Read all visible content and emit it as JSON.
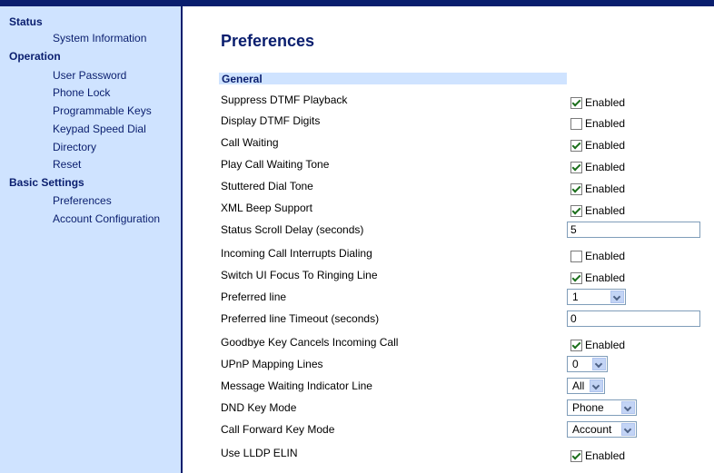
{
  "sidebar": {
    "status_heading": "Status",
    "status_items": [
      "System Information"
    ],
    "operation_heading": "Operation",
    "operation_items": [
      "User Password",
      "Phone Lock",
      "Programmable Keys",
      "Keypad Speed Dial",
      "Directory",
      "Reset"
    ],
    "basic_heading": "Basic Settings",
    "basic_items": [
      "Preferences",
      "Account Configuration"
    ]
  },
  "main": {
    "title": "Preferences",
    "section": "General",
    "rows": [
      {
        "label": "Suppress DTMF Playback",
        "type": "checkbox",
        "checked": true,
        "option_label": "Enabled"
      },
      {
        "label": "Display DTMF Digits",
        "type": "checkbox",
        "checked": false,
        "option_label": "Enabled"
      },
      {
        "label": "Call Waiting",
        "type": "checkbox",
        "checked": true,
        "option_label": "Enabled"
      },
      {
        "label": "Play Call Waiting Tone",
        "type": "checkbox",
        "checked": true,
        "option_label": "Enabled"
      },
      {
        "label": "Stuttered Dial Tone",
        "type": "checkbox",
        "checked": true,
        "option_label": "Enabled"
      },
      {
        "label": "XML Beep Support",
        "type": "checkbox",
        "checked": true,
        "option_label": "Enabled"
      },
      {
        "label": "Status Scroll Delay (seconds)",
        "type": "text",
        "value": "5"
      },
      {
        "label": "Incoming Call Interrupts Dialing",
        "type": "checkbox",
        "checked": false,
        "option_label": "Enabled"
      },
      {
        "label": "Switch UI Focus To Ringing Line",
        "type": "checkbox",
        "checked": true,
        "option_label": "Enabled"
      },
      {
        "label": "Preferred line",
        "type": "select",
        "value": "1"
      },
      {
        "label": "Preferred line Timeout (seconds)",
        "type": "text",
        "value": "0"
      },
      {
        "label": "Goodbye Key Cancels Incoming Call",
        "type": "checkbox",
        "checked": true,
        "option_label": "Enabled"
      },
      {
        "label": "UPnP Mapping Lines",
        "type": "select",
        "value": "0"
      },
      {
        "label": "Message Waiting Indicator Line",
        "type": "select",
        "value": "All"
      },
      {
        "label": "DND Key Mode",
        "type": "select",
        "value": "Phone"
      },
      {
        "label": "Call Forward Key Mode",
        "type": "select",
        "value": "Account"
      },
      {
        "label": "Use LLDP ELIN",
        "type": "checkbox",
        "checked": true,
        "option_label": "Enabled"
      }
    ]
  },
  "colors": {
    "accent": "#0a1e6e",
    "sidebar_bg": "#cfe3ff",
    "checkmark": "#1a6e1a"
  }
}
